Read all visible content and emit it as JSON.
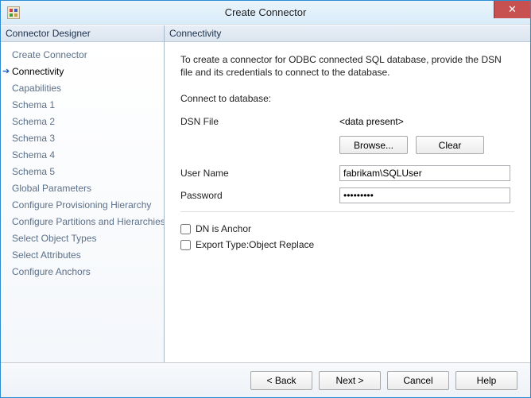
{
  "window": {
    "title": "Create Connector",
    "close_glyph": "✕"
  },
  "sidebar": {
    "header": "Connector Designer",
    "items": [
      {
        "label": "Create Connector",
        "active": false
      },
      {
        "label": "Connectivity",
        "active": true
      },
      {
        "label": "Capabilities",
        "active": false
      },
      {
        "label": "Schema 1",
        "active": false
      },
      {
        "label": "Schema 2",
        "active": false
      },
      {
        "label": "Schema 3",
        "active": false
      },
      {
        "label": "Schema 4",
        "active": false
      },
      {
        "label": "Schema 5",
        "active": false
      },
      {
        "label": "Global Parameters",
        "active": false
      },
      {
        "label": "Configure Provisioning Hierarchy",
        "active": false
      },
      {
        "label": "Configure Partitions and Hierarchies",
        "active": false
      },
      {
        "label": "Select Object Types",
        "active": false
      },
      {
        "label": "Select Attributes",
        "active": false
      },
      {
        "label": "Configure Anchors",
        "active": false
      }
    ]
  },
  "main": {
    "header": "Connectivity",
    "description": "To create a connector for ODBC connected SQL database, provide the DSN file and its credentials to connect to the database.",
    "section": "Connect to database:",
    "dsn_label": "DSN File",
    "dsn_value": "<data present>",
    "browse": "Browse...",
    "clear": "Clear",
    "user_label": "User Name",
    "user_value": "fabrikam\\SQLUser",
    "pass_label": "Password",
    "pass_value": "•••••••••",
    "cb_dn": "DN is Anchor",
    "cb_export": "Export Type:Object Replace"
  },
  "footer": {
    "back": "<  Back",
    "next": "Next  >",
    "cancel": "Cancel",
    "help": "Help"
  }
}
